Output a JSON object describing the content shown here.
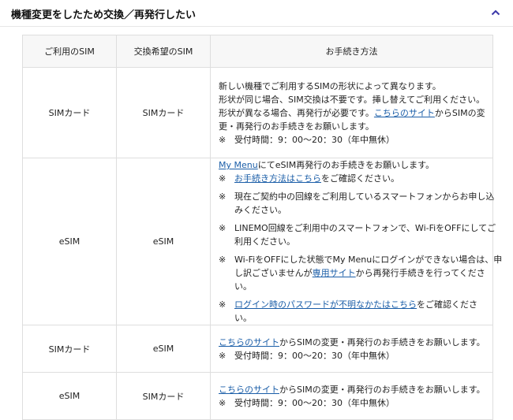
{
  "section": {
    "title": "機種変更をしたため交換／再発行したい"
  },
  "table": {
    "headers": [
      "ご利用のSIM",
      "交換希望のSIM",
      "お手続き方法"
    ],
    "rows": [
      {
        "current": "SIMカード",
        "desired": "SIMカード",
        "lines": {
          "l1": "新しい機種でご利用するSIMの形状によって異なります。",
          "l2": "形状が同じ場合、SIM交換は不要です。挿し替えてご利用ください。",
          "l3_pre": "形状が異なる場合、再発行が必要です。",
          "l3_link": "こちらのサイト",
          "l3_post": "からSIMの変",
          "l4": "更・再発行のお手続きをお願いします。",
          "mark": "※",
          "hours": "受付時間：9：00～20：30（年中無休）"
        }
      },
      {
        "current": "eSIM",
        "desired": "eSIM",
        "lines": {
          "intro_link": "My Menu",
          "intro_post": "にてeSIM再発行のお手続きをお願いします。",
          "mark": "※",
          "n1_link": "お手続き方法はこちら",
          "n1_post": "をご確認ください。",
          "n2_a": "現在ご契約中の回線をご利用しているスマートフォンからお申し込",
          "n2_b": "みください。",
          "n3_a": "LINEMO回線をご利用中のスマートフォンで、Wi-FiをOFFにしてご",
          "n3_b": "利用ください。",
          "n4_a": "Wi-FiをOFFにした状態でMy Menuにログインができない場合は、申",
          "n4_b_pre": "し訳ございませんが",
          "n4_b_link": "専用サイト",
          "n4_b_post": "から再発行手続きを行ってくださ",
          "n4_c": "い。",
          "n5_link": "ログイン時のパスワードが不明なかたはこちら",
          "n5_post": "をご確認ください。"
        }
      },
      {
        "current": "SIMカード",
        "desired": "eSIM",
        "lines": {
          "link": "こちらのサイト",
          "post": "からSIMの変更・再発行のお手続きをお願いします。",
          "mark": "※",
          "hours": "受付時間：9：00～20：30（年中無休）"
        }
      },
      {
        "current": "eSIM",
        "desired": "SIMカード",
        "lines": {
          "link": "こちらのサイト",
          "post": "からSIMの変更・再発行のお手続きをお願いします。",
          "mark": "※",
          "hours": "受付時間：9：00～20：30（年中無休）"
        }
      }
    ]
  },
  "colors": {
    "link": "#1b5ea8",
    "accent": "#3a37a8",
    "header_bg": "#f7f7f7",
    "border": "#dedede"
  },
  "icons": {
    "toggle": "chevron-up-icon"
  }
}
